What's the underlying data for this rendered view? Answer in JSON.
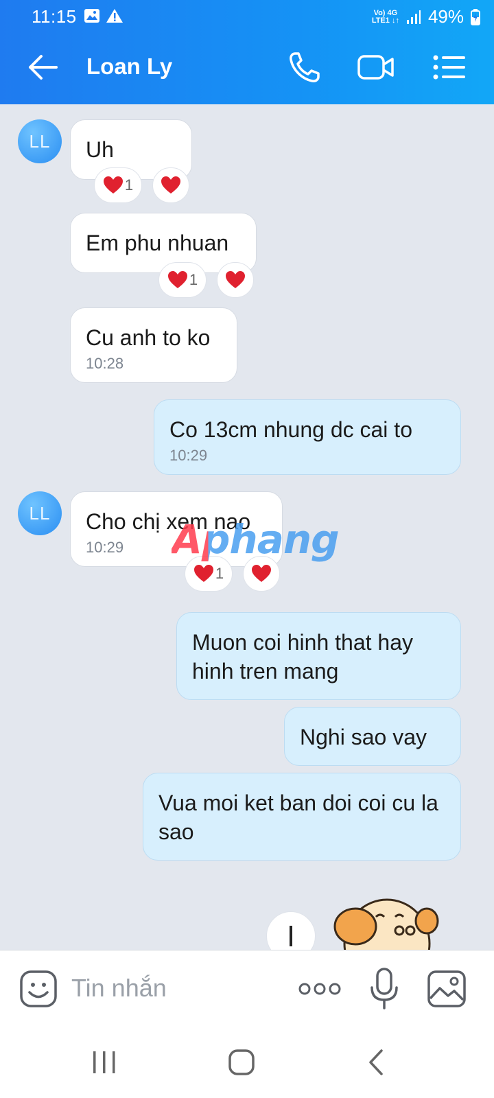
{
  "status": {
    "time": "11:15",
    "net_top": "Vo) 4G",
    "net_bottom": "LTE1 ↓↑",
    "battery": "49%"
  },
  "header": {
    "title": "Loan Ly"
  },
  "contact": {
    "initials": "LL"
  },
  "messages": [
    {
      "from": "them",
      "text": "Uh",
      "time": "",
      "reaction_count": "1"
    },
    {
      "from": "them",
      "text": "Em phu nhuan",
      "time": "",
      "reaction_count": "1"
    },
    {
      "from": "them",
      "text": "Cu anh to ko",
      "time": "10:28"
    },
    {
      "from": "me",
      "text": "Co 13cm nhung dc cai to",
      "time": "10:29"
    },
    {
      "from": "them",
      "text": "Cho chị xem nao",
      "time": "10:29",
      "reaction_count": "1"
    },
    {
      "from": "me",
      "text": "Muon coi hinh that hay hinh tren mang"
    },
    {
      "from": "me",
      "text": "Nghi sao vay"
    },
    {
      "from": "me",
      "text": "Vua moi ket ban doi coi cu la sao"
    }
  ],
  "watermark": "Aphang",
  "input": {
    "placeholder": "Tin nhắn"
  },
  "colors": {
    "header_start": "#1f7bf0",
    "header_end": "#12a7f7",
    "bubble_out": "#d7effd",
    "bubble_in": "#ffffff",
    "heart": "#e0212f"
  }
}
